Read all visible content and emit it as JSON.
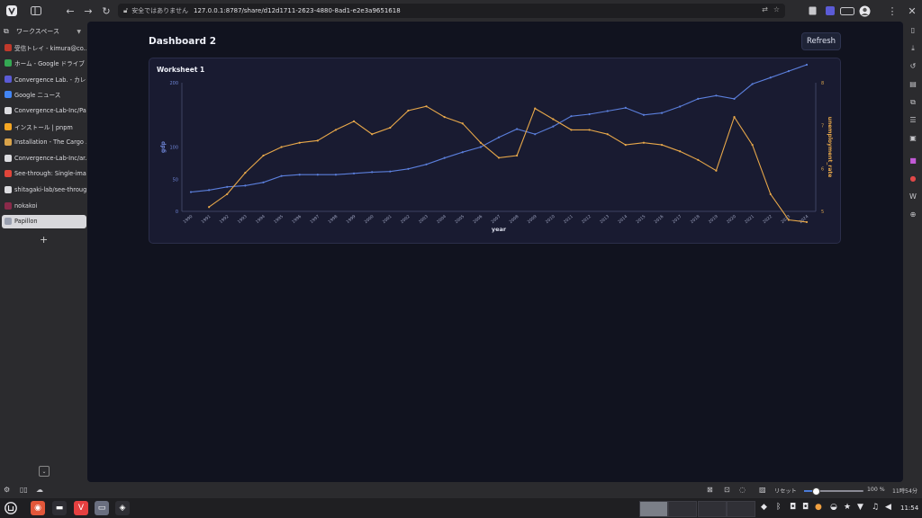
{
  "browser": {
    "security_warning": "安全ではありません",
    "url": "127.0.0.1:8787/share/d12d1711-2623-4880-8ad1-e2e3a9651618"
  },
  "sidebar": {
    "workspace_label": "ワークスペース",
    "tabs": [
      {
        "label": "受信トレイ - kimura@co...",
        "color": "#c0392b"
      },
      {
        "label": "ホーム - Google ドライブ",
        "color": "#34a853"
      },
      {
        "label": "Convergence Lab. - カレ...",
        "color": "#5b5bd6"
      },
      {
        "label": "Google ニュース",
        "color": "#4285f4"
      },
      {
        "label": "Convergence-Lab-Inc/Pa...",
        "color": "#dcdce0"
      },
      {
        "label": "インストール | pnpm",
        "color": "#f5a623"
      },
      {
        "label": "Installation - The Cargo ...",
        "color": "#d9a34a"
      },
      {
        "label": "Convergence-Lab-Inc/ar...",
        "color": "#dcdce0"
      },
      {
        "label": "See-through: Single-ima...",
        "color": "#e0453a"
      },
      {
        "label": "shitagaki-lab/see-throug...",
        "color": "#dcdce0"
      },
      {
        "label": "nokakoi",
        "color": "#8a2a4a"
      },
      {
        "label": "Papillon",
        "color": "#9aa0b0"
      }
    ],
    "add_tab": "+"
  },
  "dashboard": {
    "title": "Dashboard 2",
    "refresh_label": "Refresh",
    "worksheet_title": "Worksheet 1"
  },
  "colors": {
    "gdp": "#5b7fdc",
    "unemployment": "#e8a84a"
  },
  "chart_data": {
    "type": "line",
    "x": [
      1990,
      1991,
      1992,
      1993,
      1994,
      1995,
      1996,
      1997,
      1998,
      1999,
      2000,
      2001,
      2002,
      2003,
      2004,
      2005,
      2006,
      2007,
      2008,
      2009,
      2010,
      2011,
      2012,
      2013,
      2014,
      2015,
      2016,
      2017,
      2018,
      2019,
      2020,
      2021,
      2022,
      2023,
      2024
    ],
    "xlabel": "year",
    "series": [
      {
        "name": "gdp",
        "axis": "left",
        "values": [
          30,
          33,
          38,
          40,
          45,
          55,
          57,
          57,
          57,
          59,
          61,
          62,
          66,
          73,
          83,
          92,
          100,
          115,
          128,
          120,
          132,
          148,
          151,
          156,
          161,
          150,
          153,
          163,
          175,
          180,
          175,
          198,
          208,
          218,
          228
        ]
      },
      {
        "name": "unemployment_rate",
        "axis": "right",
        "values": [
          null,
          5.1,
          5.4,
          5.9,
          6.3,
          6.5,
          6.6,
          6.65,
          6.9,
          7.1,
          6.8,
          6.95,
          7.35,
          7.45,
          7.2,
          7.05,
          6.6,
          6.25,
          6.3,
          7.4,
          7.15,
          6.9,
          6.9,
          6.8,
          6.55,
          6.6,
          6.55,
          6.4,
          6.2,
          5.95,
          7.2,
          6.55,
          5.4,
          4.8,
          4.75
        ]
      }
    ],
    "yleft": {
      "label": "gdp",
      "ticks": [
        0,
        50,
        100,
        200
      ]
    },
    "yright": {
      "label": "unemployment_rate",
      "ticks": [
        5,
        6,
        7,
        8
      ]
    }
  },
  "statusbar": {
    "reset_label": "リセット",
    "zoom": "100 %",
    "zoom_level": 0.2,
    "time_short": "11時54分"
  },
  "taskbar": {
    "clock": "11:54"
  }
}
